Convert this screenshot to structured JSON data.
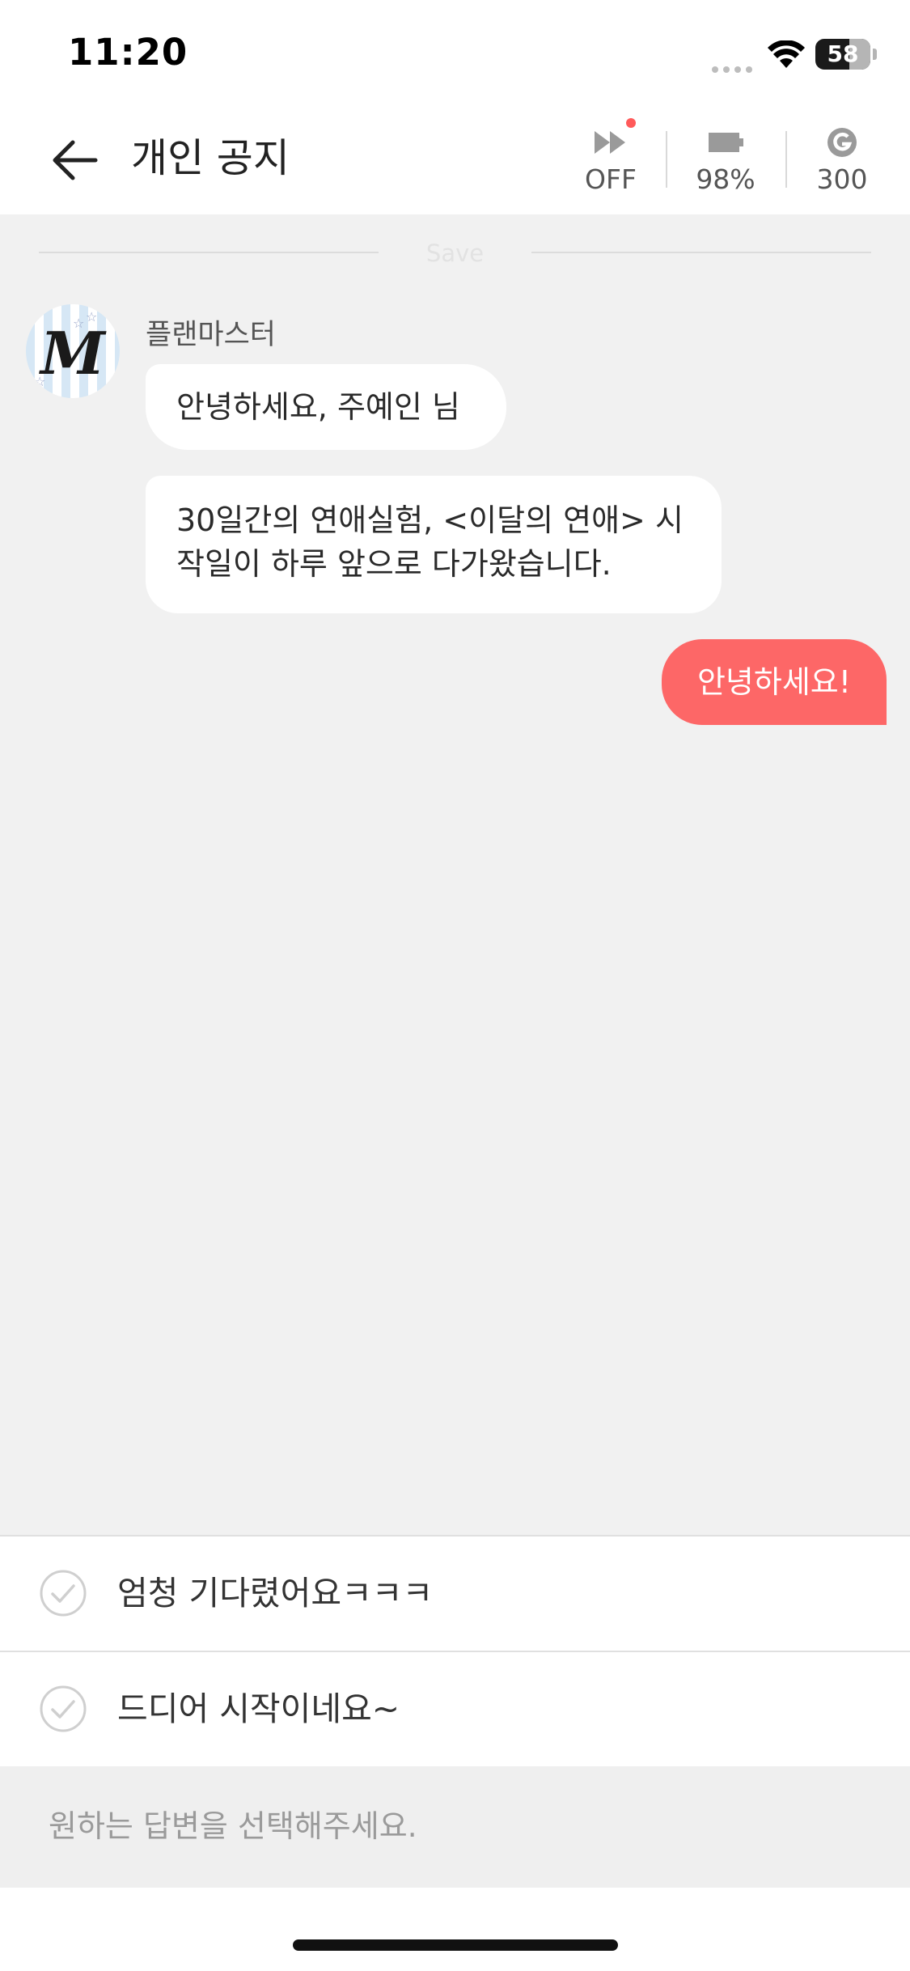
{
  "status_bar": {
    "time": "11:20",
    "battery_level": "58"
  },
  "header": {
    "title": "개인 공지",
    "autoplay_label": "OFF",
    "battery_label": "98%",
    "coin_label": "300"
  },
  "save_label": "Save",
  "chat": {
    "sender_name": "플랜마스터",
    "avatar_letter": "M",
    "messages": [
      {
        "text": "안녕하세요, 주예인 님"
      },
      {
        "lines": [
          "30일간의 연애실험, <이달의 연애> 시",
          "작일이 하루 앞으로 다가왔습니다."
        ]
      }
    ],
    "my_reply": "안녕하세요!"
  },
  "reply_options": [
    {
      "label": "엄청 기다렸어요ㅋㅋㅋ"
    },
    {
      "label": "드디어 시작이네요~"
    }
  ],
  "prompt": "원하는 답변을 선택해주세요.",
  "colors": {
    "accent": "#fd6767",
    "background": "#f1f1f1",
    "notification_dot": "#ff5a5a"
  }
}
